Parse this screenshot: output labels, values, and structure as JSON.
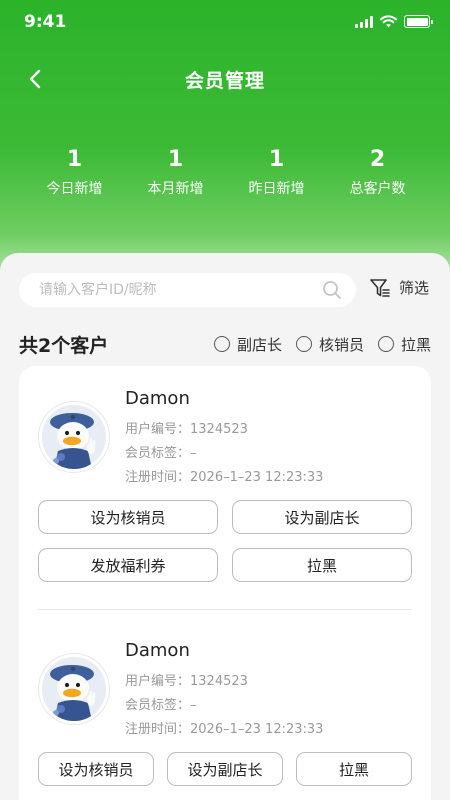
{
  "status_bar": {
    "time": "9:41"
  },
  "header": {
    "title": "会员管理"
  },
  "stats": [
    {
      "value": "1",
      "label": "今日新增"
    },
    {
      "value": "1",
      "label": "本月新增"
    },
    {
      "value": "1",
      "label": "昨日新增"
    },
    {
      "value": "2",
      "label": "总客户数"
    }
  ],
  "search": {
    "placeholder": "请输入客户ID/昵称",
    "value": ""
  },
  "filter": {
    "label": "筛选"
  },
  "summary": {
    "count_text": "共2个客户"
  },
  "role_filters": [
    {
      "label": "副店长",
      "checked": false
    },
    {
      "label": "核销员",
      "checked": false
    },
    {
      "label": "拉黑",
      "checked": false
    }
  ],
  "customers": [
    {
      "name": "Damon",
      "id_label": "用户编号：",
      "id_value": "1324523",
      "tag_label": "会员标签：",
      "tag_value": "–",
      "reg_label": "注册时间：",
      "reg_value": "2026–1–23 12:23:33",
      "actions": [
        "设为核销员",
        "设为副店长",
        "发放福利券",
        "拉黑"
      ]
    },
    {
      "name": "Damon",
      "id_label": "用户编号：",
      "id_value": "1324523",
      "tag_label": "会员标签：",
      "tag_value": "–",
      "reg_label": "注册时间：",
      "reg_value": "2026–1–23 12:23:33",
      "actions": [
        "设为核销员",
        "设为副店长",
        "拉黑"
      ]
    }
  ],
  "colors": {
    "brand_green": "#2bb32a"
  }
}
